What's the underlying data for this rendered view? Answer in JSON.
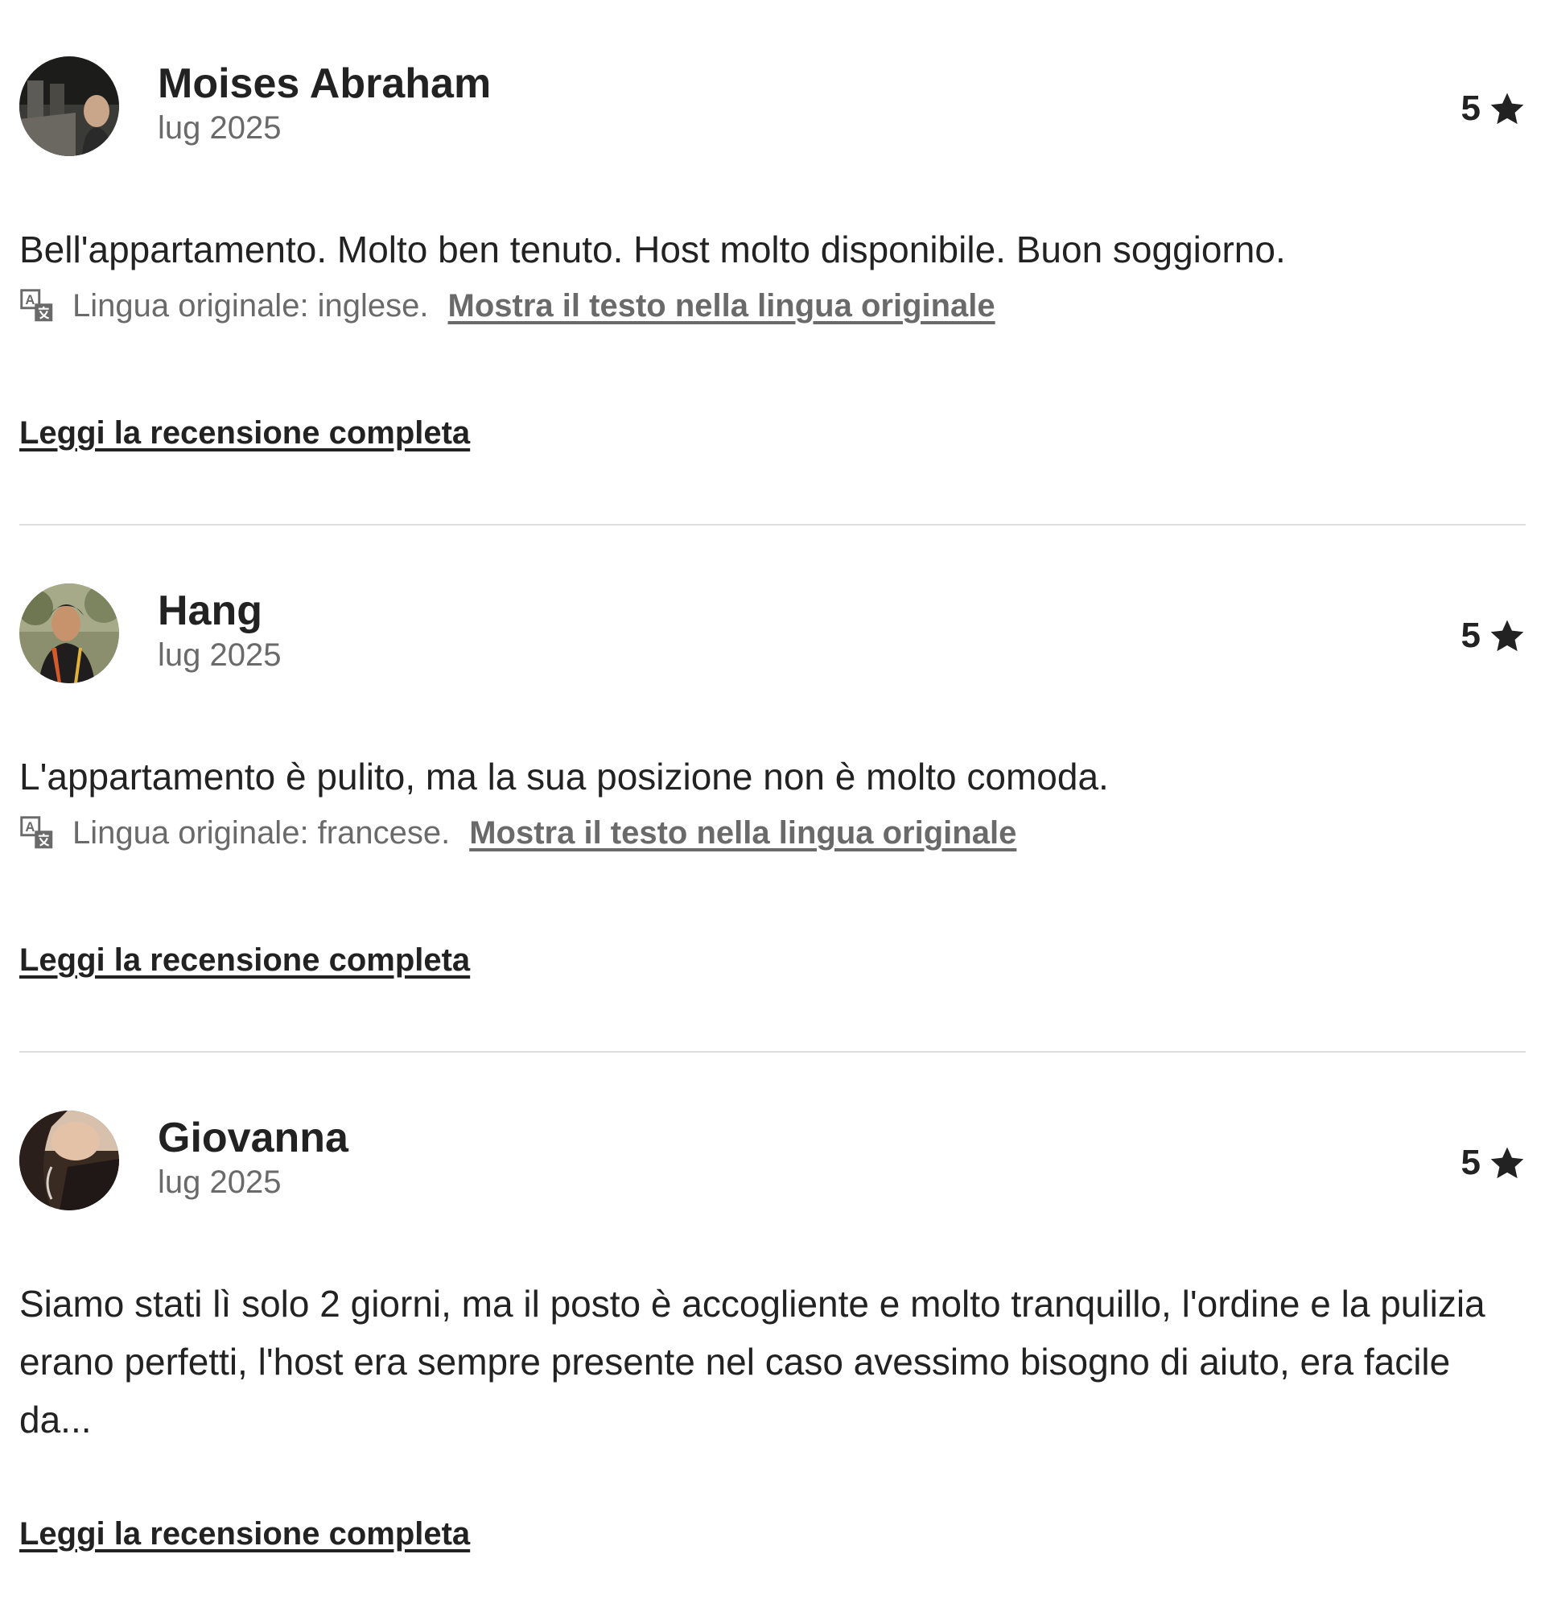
{
  "reviews": [
    {
      "name": "Moises Abraham",
      "date": "lug 2025",
      "rating": "5",
      "text": "Bell'appartamento. Molto ben tenuto. Host molto disponibile. Buon soggiorno.",
      "original_language": "Lingua originale: inglese.",
      "show_original_label": "Mostra il testo nella lingua originale",
      "read_more_label": "Leggi la recensione completa"
    },
    {
      "name": "Hang",
      "date": "lug 2025",
      "rating": "5",
      "text": "L'appartamento è pulito, ma la sua posizione non è molto comoda.",
      "original_language": "Lingua originale: francese.",
      "show_original_label": "Mostra il testo nella lingua originale",
      "read_more_label": "Leggi la recensione completa"
    },
    {
      "name": "Giovanna",
      "date": "lug 2025",
      "rating": "5",
      "text": "Siamo stati lì solo 2 giorni, ma il posto è accogliente e molto tranquillo, l'ordine e la pulizia erano perfetti, l'host era sempre presente nel caso avessimo bisogno di aiuto, era facile da...",
      "read_more_label": "Leggi la recensione completa"
    }
  ],
  "colors": {
    "text_primary": "#222222",
    "text_secondary": "#6a6a6a",
    "divider": "#dddddd"
  },
  "icons": {
    "rating": "star-icon",
    "translation": "translate-icon"
  }
}
